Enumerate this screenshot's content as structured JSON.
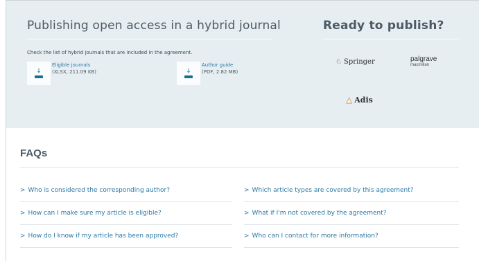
{
  "publish": {
    "title": "Publishing open access in a hybrid journal",
    "check_text": "Check the list of hybrid journals that are included in the agreement.",
    "downloads": [
      {
        "name": "Eligible journals",
        "meta": "(XLSX, 211.09 KB)"
      },
      {
        "name": "Author guide",
        "meta": "(PDF, 2.82 MB)"
      }
    ],
    "arrow_glyph": "↓"
  },
  "ready": {
    "title": "Ready to publish?",
    "logos": {
      "springer": {
        "mark": "♘",
        "text": "Springer"
      },
      "palgrave": {
        "main": "palgrave",
        "sub": "macmillan"
      },
      "adis": {
        "mark": "△",
        "text": "Adis",
        "mark_color": "#e68a2a"
      }
    }
  },
  "faqs": {
    "title": "FAQs",
    "chevron": ">",
    "left": [
      "Who is considered the corresponding author?",
      "How can I make sure my article is eligible?",
      "How do I know if my article has been approved?"
    ],
    "right": [
      "Which article types are covered by this agreement?",
      "What if I'm not covered by the agreement?",
      "Who can I contact for more information?"
    ]
  },
  "colors": {
    "panel_bg": "#e7eef2",
    "link": "#2a79a6",
    "icon": "#1b6d91",
    "heading": "#4b5a64"
  }
}
